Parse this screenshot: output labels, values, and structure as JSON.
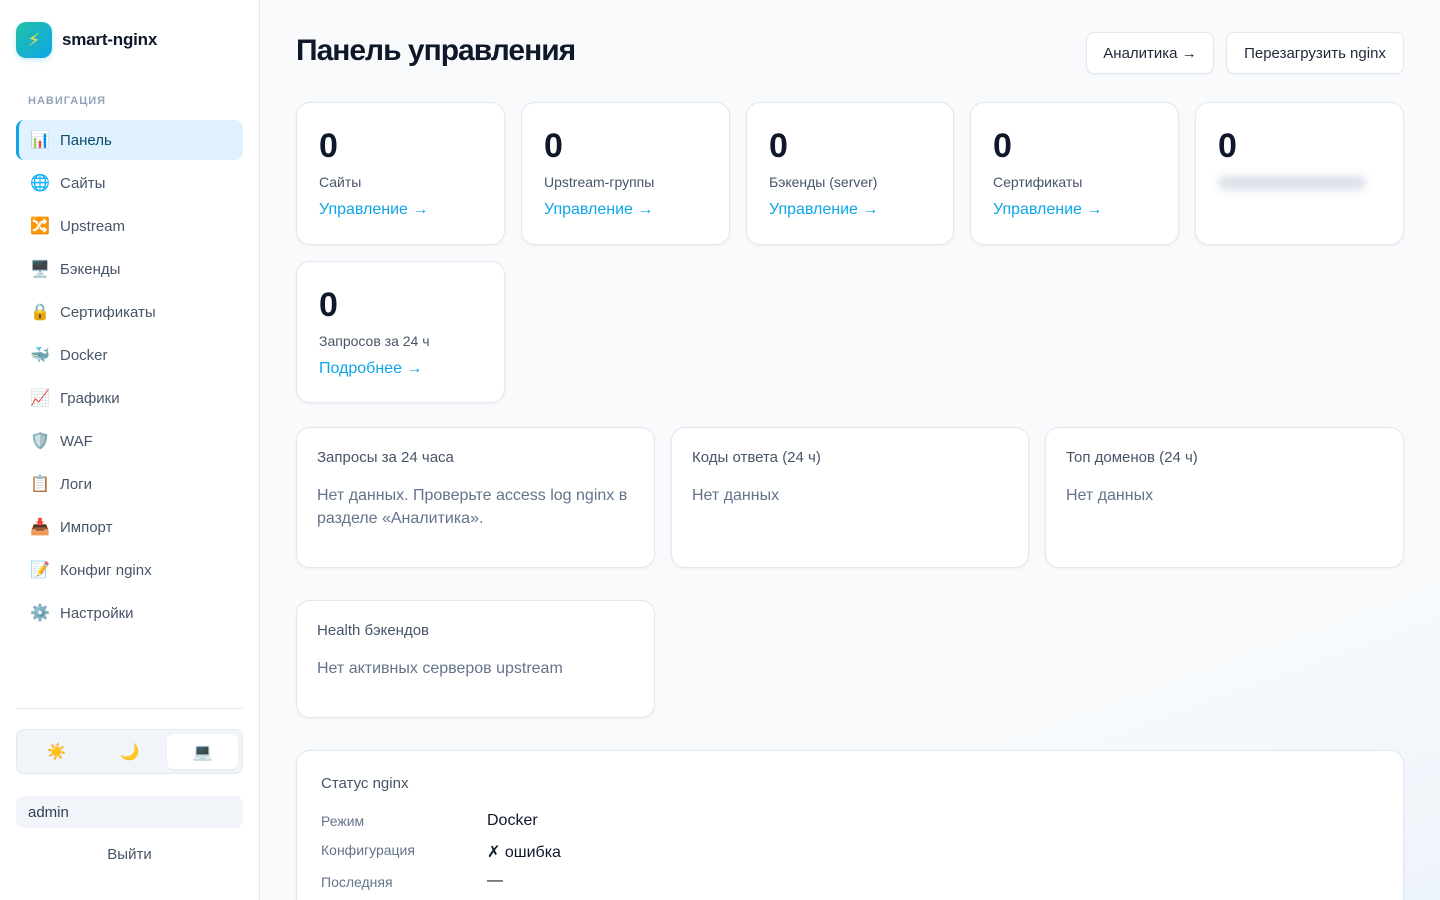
{
  "brand": {
    "name": "smart-nginx",
    "logo_icon": "⚡"
  },
  "nav": {
    "heading": "НАВИГАЦИЯ",
    "items": [
      {
        "icon": "📊",
        "label": "Панель",
        "active": true
      },
      {
        "icon": "🌐",
        "label": "Сайты"
      },
      {
        "icon": "🔀",
        "label": "Upstream"
      },
      {
        "icon": "🖥️",
        "label": "Бэкенды"
      },
      {
        "icon": "🔒",
        "label": "Сертификаты"
      },
      {
        "icon": "🐳",
        "label": "Docker"
      },
      {
        "icon": "📈",
        "label": "Графики"
      },
      {
        "icon": "🛡️",
        "label": "WAF"
      },
      {
        "icon": "📋",
        "label": "Логи"
      },
      {
        "icon": "📥",
        "label": "Импорт"
      },
      {
        "icon": "📝",
        "label": "Конфиг nginx"
      },
      {
        "icon": "⚙️",
        "label": "Настройки"
      }
    ]
  },
  "theme": {
    "light": "☀️",
    "dark": "🌙",
    "system": "💻",
    "selected": "system"
  },
  "user": {
    "name": "admin",
    "logout": "Выйти"
  },
  "header": {
    "title": "Панель управления",
    "analytics_btn": "Аналитика →",
    "reload_btn": "Перезагрузить nginx"
  },
  "stats": [
    {
      "value": "0",
      "label": "Сайты",
      "link": "Управление →"
    },
    {
      "value": "0",
      "label": "Upstream-группы",
      "link": "Управление →"
    },
    {
      "value": "0",
      "label": "Бэкенды (server)",
      "link": "Управление →"
    },
    {
      "value": "0",
      "label": "Сертификаты",
      "link": "Управление →"
    },
    {
      "value": "0"
    },
    {
      "value": "0",
      "label": "Запросов за 24 ч",
      "link": "Подробнее →"
    }
  ],
  "panels": {
    "requests": {
      "title": "Запросы за 24 часа",
      "text": "Нет данных. Проверьте access log nginx в разделе «Аналитика»."
    },
    "codes": {
      "title": "Коды ответа (24 ч)",
      "text": "Нет данных"
    },
    "domains": {
      "title": "Топ доменов (24 ч)",
      "text": "Нет данных"
    },
    "health": {
      "title": "Health бэкендов",
      "text": "Нет активных серверов upstream"
    }
  },
  "nginx_status": {
    "title": "Статус nginx",
    "rows": [
      {
        "key": "Режим",
        "value": "Docker"
      },
      {
        "key": "Конфигурация",
        "value": "✗ ошибка"
      },
      {
        "key": "Последняя",
        "value": "—"
      }
    ]
  },
  "colors": {
    "accent": "#0ea5e9",
    "active_bg": "#e0f2fe",
    "text": "#0f172a",
    "muted": "#64748b"
  }
}
